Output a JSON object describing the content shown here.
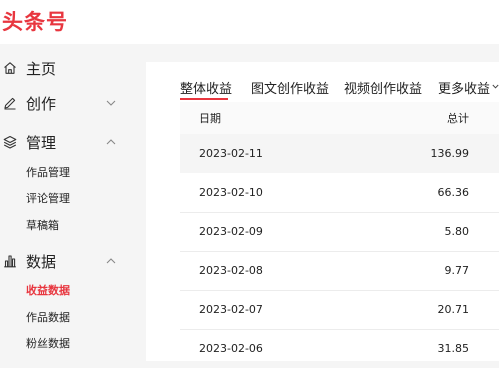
{
  "app": {
    "logo_text": "头条号",
    "brand_color": "#e8363f"
  },
  "sidebar": {
    "home": {
      "label": "主页",
      "icon": "home-icon"
    },
    "create": {
      "label": "创作",
      "icon": "pen-icon",
      "chevron": "chevron-down-icon"
    },
    "manage": {
      "label": "管理",
      "icon": "layers-icon",
      "chevron": "chevron-up-icon",
      "items": [
        {
          "label": "作品管理"
        },
        {
          "label": "评论管理"
        },
        {
          "label": "草稿箱"
        }
      ]
    },
    "data": {
      "label": "数据",
      "icon": "bar-chart-icon",
      "chevron": "chevron-up-icon",
      "items": [
        {
          "label": "收益数据",
          "active": true
        },
        {
          "label": "作品数据"
        },
        {
          "label": "粉丝数据"
        }
      ]
    }
  },
  "tabs": [
    {
      "label": "整体收益",
      "active": true
    },
    {
      "label": "图文创作收益"
    },
    {
      "label": "视频创作收益"
    },
    {
      "label": "更多收益"
    }
  ],
  "table": {
    "headers": {
      "date": "日期",
      "total": "总计"
    },
    "rows": [
      {
        "date": "2023-02-11",
        "total": "136.99"
      },
      {
        "date": "2023-02-10",
        "total": "66.36"
      },
      {
        "date": "2023-02-09",
        "total": "5.80"
      },
      {
        "date": "2023-02-08",
        "total": "9.77"
      },
      {
        "date": "2023-02-07",
        "total": "20.71"
      },
      {
        "date": "2023-02-06",
        "total": "31.85"
      }
    ]
  }
}
